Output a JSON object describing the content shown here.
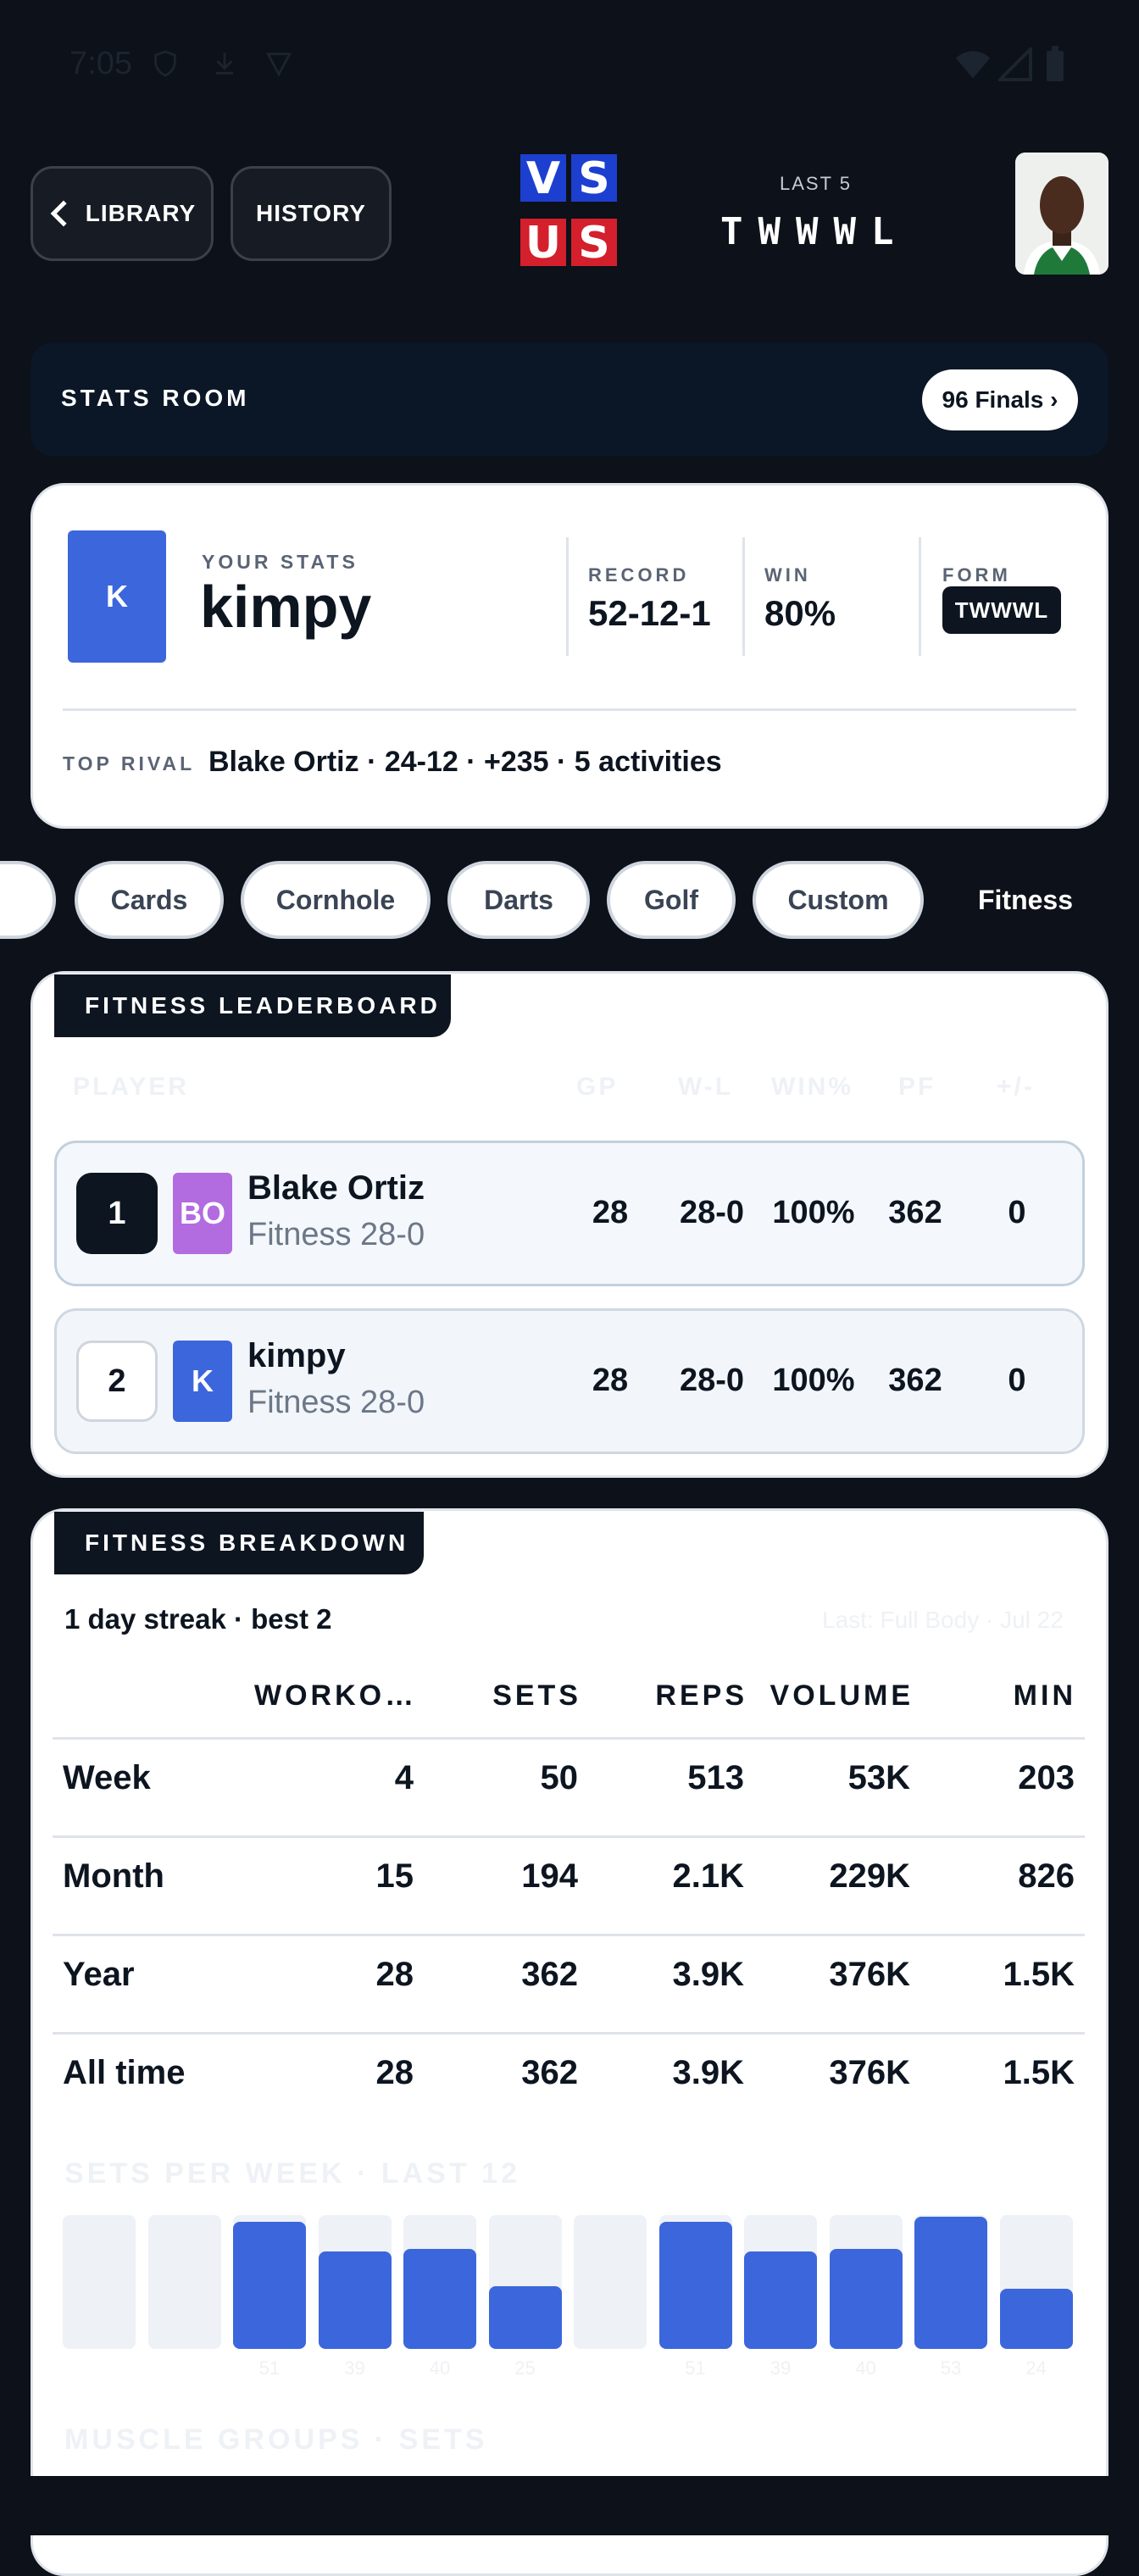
{
  "status": {
    "time": "7:05"
  },
  "header": {
    "library_label": "LIBRARY",
    "history_label": "HISTORY",
    "logo": {
      "top": [
        "V",
        "S"
      ],
      "bottom": [
        "U",
        "S"
      ]
    },
    "last5_label": "LAST 5",
    "last5_value": "TWWWL"
  },
  "stats_room": {
    "title": "STATS ROOM",
    "finals_label": "96 Finals ›"
  },
  "your_stats": {
    "avatar_letter": "K",
    "label": "YOUR STATS",
    "name": "kimpy",
    "record_label": "RECORD",
    "record": "52-12-1",
    "win_label": "WIN",
    "win": "80%",
    "form_label": "FORM",
    "form": "TWWWL",
    "top_rival_label": "TOP RIVAL",
    "top_rival": "Blake Ortiz · 24-12 · +235 · 5 activities"
  },
  "tabs": [
    {
      "label": "Cards"
    },
    {
      "label": "Cornhole"
    },
    {
      "label": "Darts"
    },
    {
      "label": "Golf"
    },
    {
      "label": "Custom"
    },
    {
      "label": "Fitness",
      "active": true
    }
  ],
  "leaderboard": {
    "title": "FITNESS LEADERBOARD",
    "columns": [
      "PLAYER",
      "GP",
      "W-L",
      "WIN%",
      "PF",
      "+/-"
    ],
    "rows": [
      {
        "rank": "1",
        "initials": "BO",
        "color": "#b36be0",
        "name": "Blake Ortiz",
        "sub": "Fitness 28-0",
        "gp": "28",
        "wl": "28-0",
        "winpct": "100%",
        "pf": "362",
        "diff": "0"
      },
      {
        "rank": "2",
        "initials": "K",
        "color": "#3c66dc",
        "name": "kimpy",
        "sub": "Fitness 28-0",
        "gp": "28",
        "wl": "28-0",
        "winpct": "100%",
        "pf": "362",
        "diff": "0"
      }
    ]
  },
  "breakdown": {
    "title": "FITNESS BREAKDOWN",
    "streak": "1 day streak · best 2",
    "last_note": "Last: Full Body · Jul 22",
    "columns": [
      "WORKO…",
      "SETS",
      "REPS",
      "VOLUME",
      "MIN"
    ],
    "rows": [
      {
        "label": "Week",
        "values": [
          "4",
          "50",
          "513",
          "53K",
          "203"
        ]
      },
      {
        "label": "Month",
        "values": [
          "15",
          "194",
          "2.1K",
          "229K",
          "826"
        ]
      },
      {
        "label": "Year",
        "values": [
          "28",
          "362",
          "3.9K",
          "376K",
          "1.5K"
        ]
      },
      {
        "label": "All time",
        "values": [
          "28",
          "362",
          "3.9K",
          "376K",
          "1.5K"
        ]
      }
    ],
    "sets_title": "SETS PER WEEK · LAST 12",
    "sets_per_week": [
      {
        "label": "",
        "value": 0
      },
      {
        "label": "",
        "value": 0
      },
      {
        "label": "51",
        "value": 51
      },
      {
        "label": "39",
        "value": 39
      },
      {
        "label": "40",
        "value": 40
      },
      {
        "label": "25",
        "value": 25
      },
      {
        "label": "",
        "value": 0
      },
      {
        "label": "51",
        "value": 51
      },
      {
        "label": "39",
        "value": 39
      },
      {
        "label": "40",
        "value": 40
      },
      {
        "label": "53",
        "value": 53
      },
      {
        "label": "24",
        "value": 24
      }
    ],
    "muscle_title": "MUSCLE GROUPS · SETS"
  }
}
